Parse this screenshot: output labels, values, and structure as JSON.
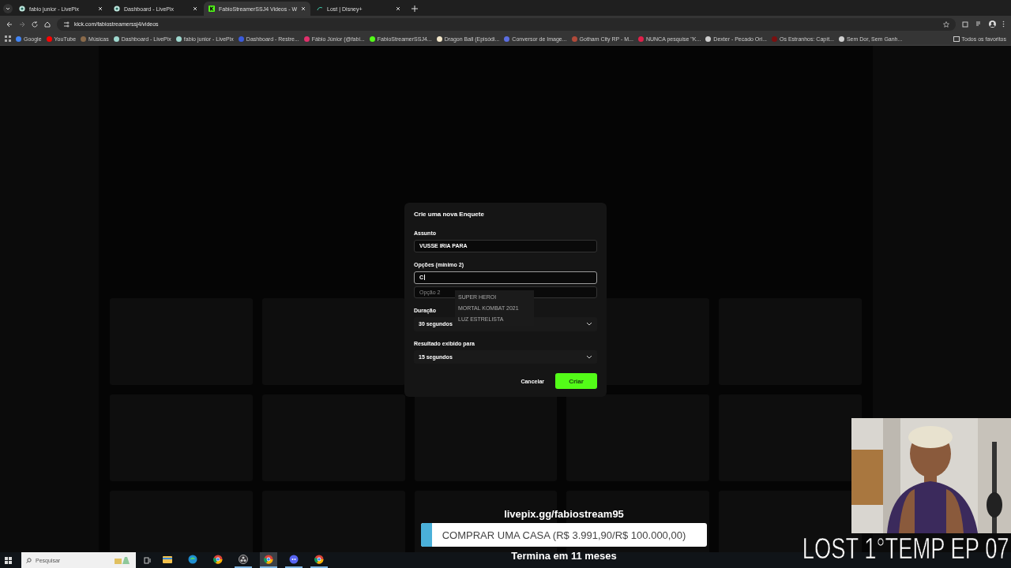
{
  "browser": {
    "tabs": [
      {
        "title": "fabio junior - LivePix",
        "kind": "livepix",
        "selected": false
      },
      {
        "title": "Dashboard - LivePix",
        "kind": "livepix",
        "selected": false
      },
      {
        "title": "FabioStreamerSSJ4 Videos - W",
        "kind": "kick",
        "selected": true
      },
      {
        "title": "Lost | Disney+",
        "kind": "disney",
        "selected": false
      }
    ],
    "url": "kick.com/fabiostreamerssj4/videos",
    "bookmarks": [
      {
        "label": "Google",
        "color": "#4285f4"
      },
      {
        "label": "YouTube",
        "color": "#ff0000"
      },
      {
        "label": "Músicas",
        "color": "#8a6a4a"
      },
      {
        "label": "Dashboard - LivePix",
        "color": "#9fd8cf"
      },
      {
        "label": "fabio junior - LivePix",
        "color": "#9fd8cf"
      },
      {
        "label": "Dashboard - Restre...",
        "color": "#3b5bdb"
      },
      {
        "label": "Fábio Júnior (@fabi...",
        "color": "#e1306c"
      },
      {
        "label": "FabioStreamerSSJ4...",
        "color": "#53fc18"
      },
      {
        "label": "Dragon Ball (Episódi...",
        "color": "#f2e6c9"
      },
      {
        "label": "Conversor de Image...",
        "color": "#5b6ee1"
      },
      {
        "label": "Gotham City RP - M...",
        "color": "#b04a3a"
      },
      {
        "label": "NUNCA pesquise \"K...",
        "color": "#e0204a"
      },
      {
        "label": "Dexter - Pecado Ori...",
        "color": "#cfcfcf"
      },
      {
        "label": "Os Estranhos: Capít...",
        "color": "#7a1010"
      },
      {
        "label": "Sem Dor, Sem Ganh...",
        "color": "#cfcfcf"
      }
    ],
    "all_bookmarks": "Todos os favoritos"
  },
  "poll_dialog": {
    "title": "Crie uma nova Enquete",
    "subject_label": "Assunto",
    "subject_value": "VUSSE IRIA PARA",
    "options_label": "Opções (mínimo 2)",
    "options": [
      {
        "value": "C",
        "focused": true
      },
      {
        "placeholder": "Opção 2",
        "focused": false
      }
    ],
    "suggestions": [
      "SUPER HEROI",
      "MORTAL KOMBAT 2021",
      "LUZ ESTRELISTA"
    ],
    "duration_label": "Duração",
    "duration_value": "30 segundos",
    "result_label": "Resultado exibido para",
    "result_value": "15 segundos",
    "cancel": "Cancelar",
    "create": "Criar"
  },
  "stream_overlay": {
    "link": "livepix.gg/fabiostream95",
    "goal": "COMPRAR UMA CASA (R$ 3.991,90/R$ 100.000,00)",
    "level": 0.04,
    "ends": "Termina em 11 meses",
    "episode": "LOST 1°TEMP EP 07"
  },
  "taskbar": {
    "search_placeholder": "Pesquisar",
    "apps": [
      {
        "kind": "explorer",
        "running": false,
        "selected": false
      },
      {
        "kind": "edge",
        "running": false,
        "selected": false
      },
      {
        "kind": "chrome",
        "running": false,
        "selected": false
      },
      {
        "kind": "obs",
        "running": true,
        "selected": false
      },
      {
        "kind": "chrome",
        "running": true,
        "selected": true
      },
      {
        "kind": "discord",
        "running": true,
        "selected": false
      },
      {
        "kind": "chrome",
        "running": true,
        "selected": false
      }
    ]
  }
}
